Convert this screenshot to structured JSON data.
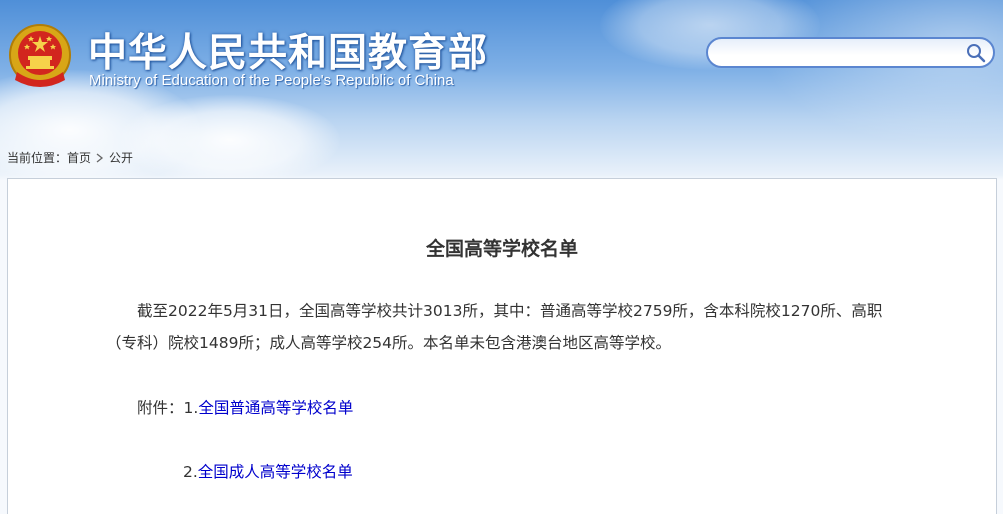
{
  "header": {
    "title": "中华人民共和国教育部",
    "subtitle": "Ministry of Education of the People's Republic of China",
    "emblem_icon": "national-emblem-icon"
  },
  "search": {
    "placeholder": "",
    "value": "",
    "icon": "search-icon"
  },
  "breadcrumb": {
    "label": "当前位置：",
    "items": [
      "首页",
      "公开"
    ],
    "separator_icon": "chevron-right-icon"
  },
  "article": {
    "title": "全国高等学校名单",
    "body": "截至2022年5月31日，全国高等学校共计3013所，其中：普通高等学校2759所，含本科院校1270所、高职（专科）院校1489所；成人高等学校254所。本名单未包含港澳台地区高等学校。",
    "attachments_label": "附件：",
    "attachments": [
      {
        "prefix": "1.",
        "text": "全国普通高等学校名单"
      },
      {
        "prefix": "2.",
        "text": "全国成人高等学校名单"
      }
    ]
  },
  "colors": {
    "banner_top": "#4f8fd8",
    "link": "#0000cc",
    "text": "#333333",
    "search_border": "#5b86d0"
  }
}
